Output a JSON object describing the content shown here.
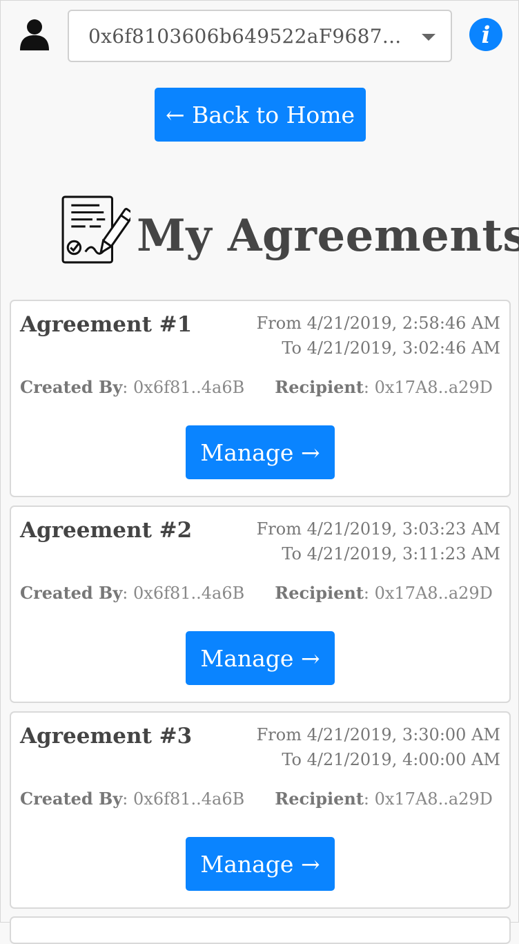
{
  "header": {
    "account_select": {
      "value": "0x6f8103606b649522aF9687..."
    },
    "info_button_label": "i",
    "user_icon": "user-icon",
    "caret_icon": "caret-down-icon"
  },
  "navigation": {
    "back_label": "← Back to Home"
  },
  "page": {
    "title": "My Agreements",
    "title_icon": "signed-document-icon"
  },
  "agreements": [
    {
      "title": "Agreement #1",
      "from": "From 4/21/2019, 2:58:46 AM",
      "to": "To 4/21/2019, 3:02:46 AM",
      "created_by_label": "Created By",
      "created_by": ": 0x6f81..4a6B",
      "recipient_label": "Recipient",
      "recipient": ": 0x17A8..a29D",
      "manage_label": "Manage →"
    },
    {
      "title": "Agreement #2",
      "from": "From 4/21/2019, 3:03:23 AM",
      "to": "To 4/21/2019, 3:11:23 AM",
      "created_by_label": "Created By",
      "created_by": ": 0x6f81..4a6B",
      "recipient_label": "Recipient",
      "recipient": ": 0x17A8..a29D",
      "manage_label": "Manage →"
    },
    {
      "title": "Agreement #3",
      "from": "From 4/21/2019, 3:30:00 AM",
      "to": "To 4/21/2019, 4:00:00 AM",
      "created_by_label": "Created By",
      "created_by": ": 0x6f81..4a6B",
      "recipient_label": "Recipient",
      "recipient": ": 0x17A8..a29D",
      "manage_label": "Manage →"
    }
  ],
  "colors": {
    "accent": "#0a84ff",
    "text": "#444444",
    "muted": "#777777",
    "background": "#f8f8f8"
  }
}
